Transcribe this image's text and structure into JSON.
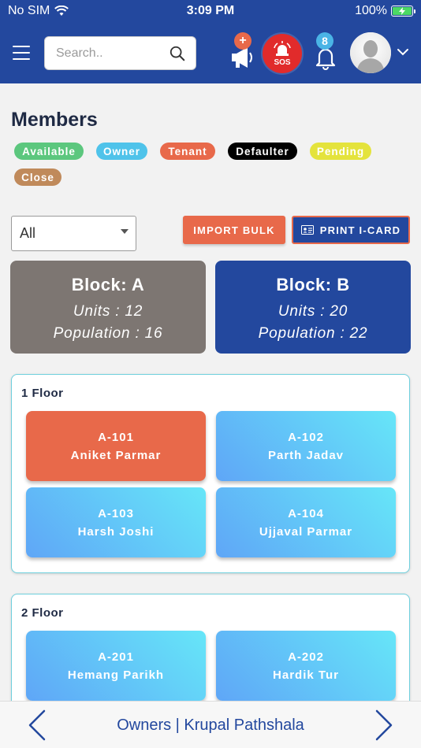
{
  "status_bar": {
    "carrier": "No SIM",
    "time": "3:09 PM",
    "battery": "100%"
  },
  "header": {
    "search_placeholder": "Search..",
    "plus_badge": "+",
    "sos_label": "SOS",
    "notification_count": "8"
  },
  "page": {
    "title": "Members"
  },
  "legend": [
    {
      "label": "Available",
      "color": "#5cc77e"
    },
    {
      "label": "Owner",
      "color": "#4fc3ea"
    },
    {
      "label": "Tenant",
      "color": "#e8694a"
    },
    {
      "label": "Defaulter",
      "color": "#000000"
    },
    {
      "label": "Pending",
      "color": "#e4e33c"
    },
    {
      "label": "Close",
      "color": "#c08a5b"
    }
  ],
  "filter": {
    "selected": "All"
  },
  "actions": {
    "import_label": "IMPORT BULK",
    "print_label": "PRINT I-CARD"
  },
  "blocks": [
    {
      "title": "Block: A",
      "units": "Units : 12",
      "population": "Population : 16",
      "color": "#7d7672"
    },
    {
      "title": "Block: B",
      "units": "Units : 20",
      "population": "Population : 22",
      "color": "#23489e"
    }
  ],
  "floors": [
    {
      "title": "1 Floor",
      "units": [
        {
          "number": "A-101",
          "name": "Aniket Parmar",
          "style": "orange"
        },
        {
          "number": "A-102",
          "name": "Parth Jadav",
          "style": "blue"
        },
        {
          "number": "A-103",
          "name": "Harsh Joshi",
          "style": "blue"
        },
        {
          "number": "A-104",
          "name": "Ujjaval Parmar",
          "style": "blue"
        }
      ]
    },
    {
      "title": "2 Floor",
      "units": [
        {
          "number": "A-201",
          "name": "Hemang Parikh",
          "style": "blue"
        },
        {
          "number": "A-202",
          "name": "Hardik Tur",
          "style": "blue"
        }
      ]
    }
  ],
  "bottom_bar": {
    "title": "Owners | Krupal Pathshala"
  },
  "colors": {
    "primary": "#23489e",
    "accent": "#e8694a",
    "sos": "#e12b2b"
  }
}
